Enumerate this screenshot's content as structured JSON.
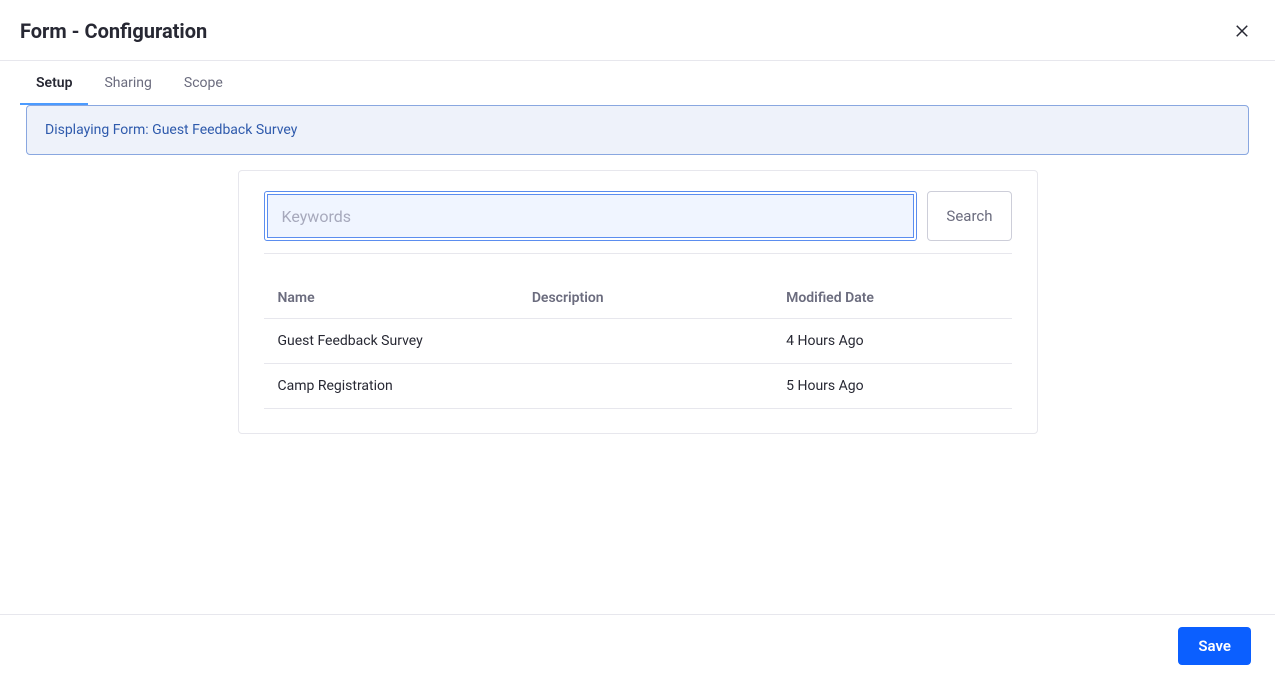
{
  "header": {
    "title": "Form - Configuration"
  },
  "tabs": [
    {
      "label": "Setup",
      "active": true
    },
    {
      "label": "Sharing",
      "active": false
    },
    {
      "label": "Scope",
      "active": false
    }
  ],
  "banner": {
    "text": "Displaying Form: Guest Feedback Survey"
  },
  "search": {
    "placeholder": "Keywords",
    "value": "",
    "button_label": "Search"
  },
  "table": {
    "columns": [
      "Name",
      "Description",
      "Modified Date"
    ],
    "rows": [
      {
        "name": "Guest Feedback Survey",
        "description": "",
        "modified": "4 Hours Ago"
      },
      {
        "name": "Camp Registration",
        "description": "",
        "modified": "5 Hours Ago"
      }
    ]
  },
  "footer": {
    "save_label": "Save"
  }
}
